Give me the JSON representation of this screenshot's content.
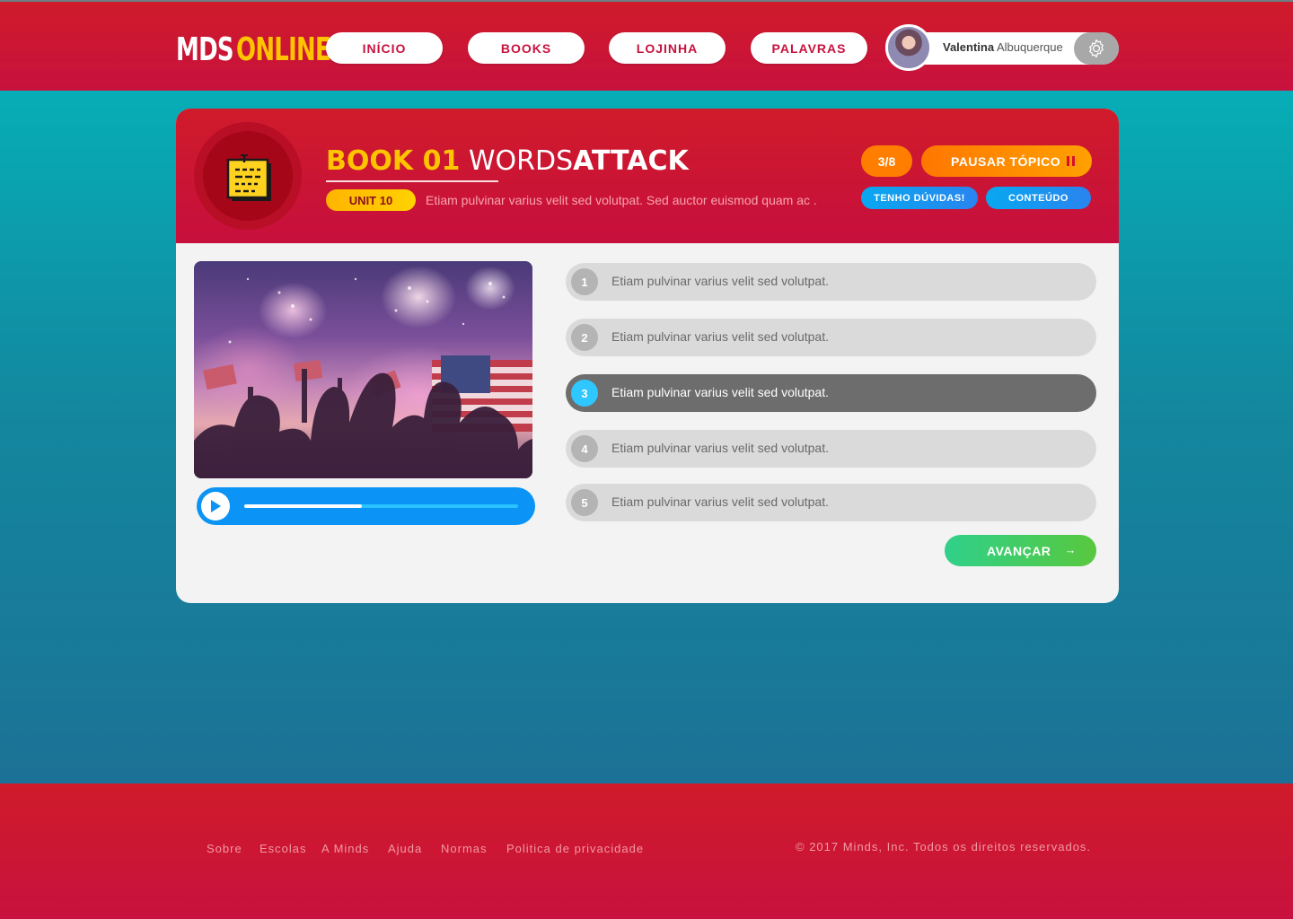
{
  "brand": {
    "logo_part1": "MDS",
    "logo_part2": "ONLINE"
  },
  "nav": [
    {
      "label": "INÍCIO"
    },
    {
      "label": "BOOKS"
    },
    {
      "label": "LOJINHA"
    },
    {
      "label": "PALAVRAS"
    }
  ],
  "user": {
    "first_name": "Valentina",
    "last_name": "Albuquerque"
  },
  "lesson": {
    "title_book": "BOOK 01",
    "title_words": "WORDS",
    "title_attack": "ATTACK",
    "unit": "UNIT 10",
    "description": "Etiam pulvinar varius velit sed volutpat. Sed auctor euismod quam ac .",
    "progress": "3/8",
    "pause_label": "PAUSAR TÓPICO",
    "doubts_label": "TENHO DÚVIDAS!",
    "content_label": "CONTEÚDO"
  },
  "player": {
    "progress_fraction": 0.43
  },
  "options": [
    {
      "number": "1",
      "text": "Etiam pulvinar varius velit sed volutpat.",
      "selected": false
    },
    {
      "number": "2",
      "text": "Etiam pulvinar varius velit sed volutpat.",
      "selected": false
    },
    {
      "number": "3",
      "text": "Etiam pulvinar varius velit sed volutpat.",
      "selected": true
    },
    {
      "number": "4",
      "text": "Etiam pulvinar varius velit sed volutpat.",
      "selected": false
    },
    {
      "number": "5",
      "text": "Etiam pulvinar varius velit sed volutpat.",
      "selected": false
    }
  ],
  "next_button": {
    "label": "AVANÇAR",
    "arrow": "→"
  },
  "footer": {
    "links": [
      "Sobre",
      "Escolas",
      "A Minds",
      "Ajuda",
      "Normas",
      "Politica de privacidade"
    ],
    "copyright": "© 2017 Minds, Inc. Todos os direitos reservados."
  },
  "colors": {
    "brand_red": "#c8113e",
    "accent_yellow": "#ffc400",
    "accent_orange": "#ff7e00",
    "accent_blue": "#0b93f5",
    "success_green": "#3ccc6a"
  },
  "icons": {
    "settings": "gear-icon",
    "pause": "pause-icon",
    "play": "play-icon",
    "lesson_badge": "sticky-note-icon"
  }
}
